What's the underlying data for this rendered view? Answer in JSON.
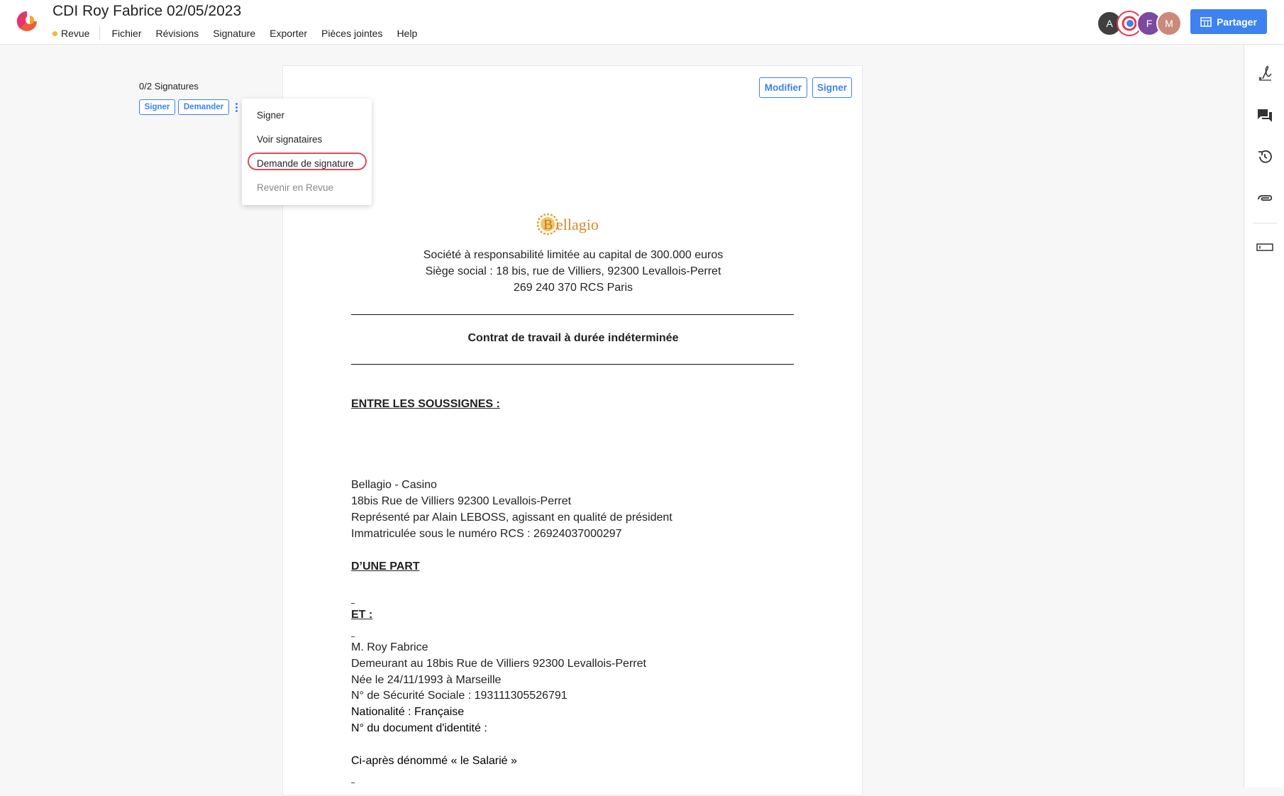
{
  "header": {
    "title": "CDI Roy Fabrice 02/05/2023",
    "status_label": "Revue",
    "menu": [
      "Fichier",
      "Révisions",
      "Signature",
      "Exporter",
      "Pièces jointes",
      "Help"
    ],
    "avatars": [
      {
        "initial": "A",
        "color": "#3f3f3f"
      },
      {
        "initial": "",
        "color": "#e33b4a"
      },
      {
        "initial": "F",
        "color": "#7b4aa0"
      },
      {
        "initial": "M",
        "color": "#c98a7a"
      }
    ],
    "share_label": "Partager",
    "accent_color": "#3d82f0"
  },
  "signature_panel": {
    "count_label": "0/2 Signatures",
    "sign_label": "Signer",
    "request_label": "Demander"
  },
  "dropdown": {
    "items": [
      "Signer",
      "Voir signataires",
      "Demande de signature",
      "Revenir en Revue"
    ],
    "highlighted": "Demande de signature",
    "disabled": "Revenir en Revue"
  },
  "document": {
    "edit_label": "Modifier",
    "sign_label": "Signer",
    "company_lines": [
      "Société à responsabilité limitée au capital de 300.000 euros",
      "Siège social : 18 bis, rue de Villiers, 92300 Levallois-Perret",
      "269 240 370 RCS Paris"
    ],
    "contract_title": "Contrat de travail à durée indéterminée",
    "between_heading": "ENTRE LES SOUSSIGNES :",
    "employer_lines": [
      "Bellagio - Casino",
      "18bis Rue de Villiers 92300 Levallois-Perret",
      "Représenté par Alain LEBOSS, agissant en qualité de président",
      "Immatriculée sous le numéro RCS : 26924037000297"
    ],
    "part_one_heading": "D’UNE PART",
    "and_heading": "ET :",
    "employee_lines": [
      "M. Roy Fabrice",
      "Demeurant au 18bis Rue de Villiers 92300 Levallois-Perret",
      "Née le 24/11/1993 à Marseille",
      "N° de Sécurité Sociale : 193111305526791",
      "Nationalité : Française",
      "N° du document d'identité :"
    ],
    "hereinafter_line": "Ci-après dénommé « le Salarié »"
  }
}
